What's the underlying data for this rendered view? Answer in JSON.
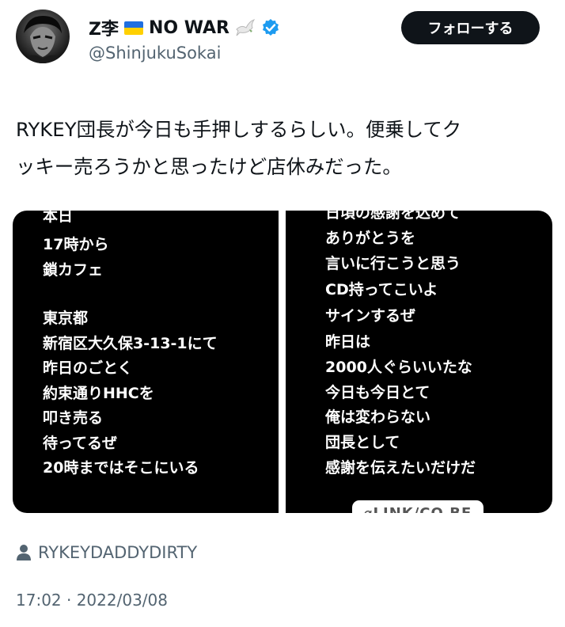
{
  "author": {
    "display_name": "Z李",
    "display_name_suffix": "NO WAR",
    "flag_icon": "ukraine-flag-icon",
    "dove_icon": "dove-icon",
    "verified_icon": "verified-badge-icon",
    "verified_color": "#1d9bf0",
    "handle": "@ShinjukuSokai"
  },
  "follow_button": {
    "label": "フォローする"
  },
  "tweet": {
    "text_line1": "RYKEY団長が今日も手押しするらしい。便乗してク",
    "text_line2": "ッキー売ろうかと思ったけど店休みだった。"
  },
  "media": {
    "left_panel": {
      "lines": [
        "本日",
        "17時から",
        "鎖カフェ",
        "東京都",
        "新宿区大久保3-13-1にて",
        "昨日のごとく",
        "約束通りHHCを",
        "叩き売る",
        "待ってるぜ",
        "20時まではそこにいる"
      ]
    },
    "right_panel": {
      "lines": [
        "日頃の感謝を込めて",
        "ありがとうを",
        "言いに行こうと思う",
        "CD持ってこいよ",
        "サインするぜ",
        "昨日は",
        "2000人ぐらいいたな",
        "今日も今日とて",
        "俺は変わらない",
        "団長として",
        "感謝を伝えたいだけだ"
      ],
      "link_sticker": "⌀LINK/CO.BE"
    }
  },
  "label": {
    "icon": "person-icon",
    "text": "RYKEYDADDYDIRTY"
  },
  "timestamp": "17:02 · 2022/03/08",
  "colors": {
    "text": "#0f1419",
    "secondary": "#536471",
    "button_bg": "#0f1419",
    "media_bg": "#000000"
  }
}
